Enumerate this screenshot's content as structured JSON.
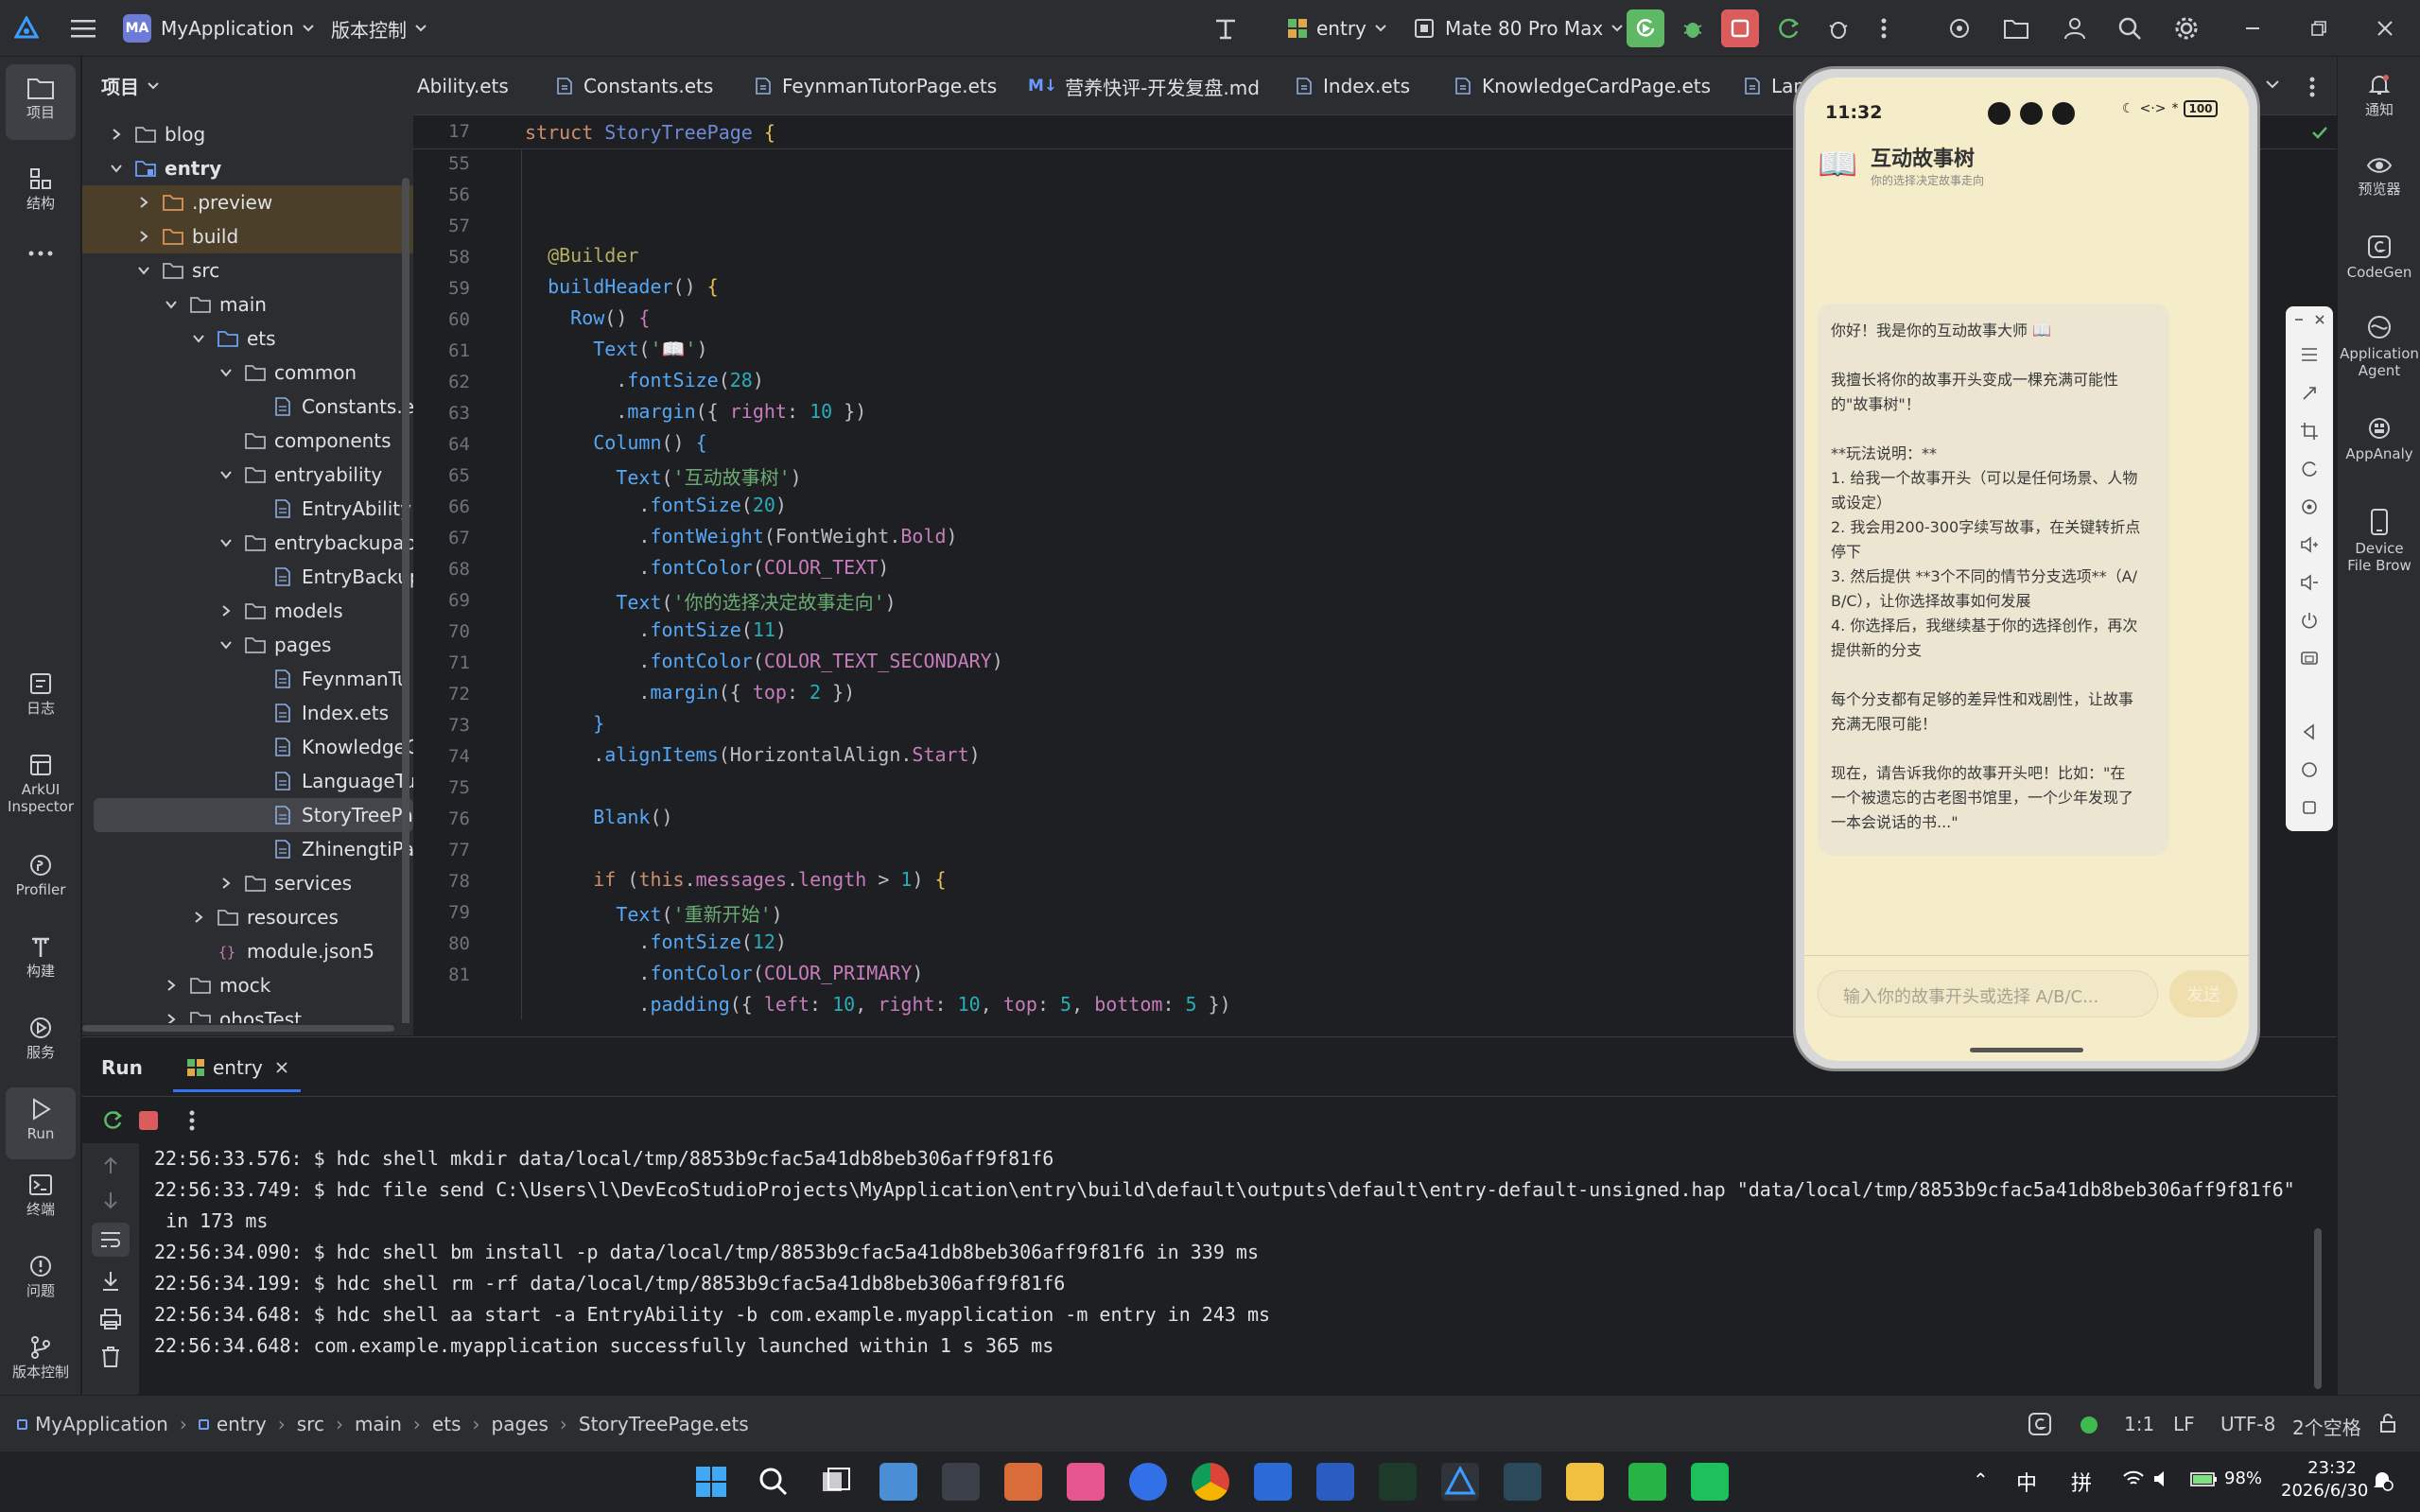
{
  "titlebar": {
    "project_badge": "MA",
    "project_name": "MyApplication",
    "vcs": "版本控制",
    "run_config": "entry",
    "device": "Mate 80 Pro Max"
  },
  "leftbar": {
    "items": [
      "项目",
      "结构",
      "日志",
      "ArkUI Inspector",
      "Profiler",
      "构建",
      "服务",
      "Run",
      "终端",
      "问题",
      "版本控制"
    ]
  },
  "project": {
    "title": "项目",
    "tree": [
      {
        "label": "blog",
        "depth": 1,
        "type": "folder",
        "exp": "closed"
      },
      {
        "label": "entry",
        "depth": 1,
        "type": "module",
        "exp": "open",
        "bold": true
      },
      {
        "label": ".preview",
        "depth": 2,
        "type": "folder-orange",
        "exp": "closed"
      },
      {
        "label": "build",
        "depth": 2,
        "type": "folder-orange",
        "exp": "closed"
      },
      {
        "label": "src",
        "depth": 2,
        "type": "folder",
        "exp": "open"
      },
      {
        "label": "main",
        "depth": 3,
        "type": "folder",
        "exp": "open"
      },
      {
        "label": "ets",
        "depth": 4,
        "type": "folder-blue",
        "exp": "open"
      },
      {
        "label": "common",
        "depth": 5,
        "type": "folder",
        "exp": "open"
      },
      {
        "label": "Constants.e",
        "depth": 6,
        "type": "file",
        "exp": "none"
      },
      {
        "label": "components",
        "depth": 5,
        "type": "folder",
        "exp": "none"
      },
      {
        "label": "entryability",
        "depth": 5,
        "type": "folder",
        "exp": "open"
      },
      {
        "label": "EntryAbility",
        "depth": 6,
        "type": "file",
        "exp": "none"
      },
      {
        "label": "entrybackupab",
        "depth": 5,
        "type": "folder",
        "exp": "open"
      },
      {
        "label": "EntryBackup",
        "depth": 6,
        "type": "file",
        "exp": "none"
      },
      {
        "label": "models",
        "depth": 5,
        "type": "folder",
        "exp": "closed"
      },
      {
        "label": "pages",
        "depth": 5,
        "type": "folder",
        "exp": "open"
      },
      {
        "label": "FeynmanTu",
        "depth": 6,
        "type": "file",
        "exp": "none"
      },
      {
        "label": "Index.ets",
        "depth": 6,
        "type": "file",
        "exp": "none"
      },
      {
        "label": "KnowledgeC",
        "depth": 6,
        "type": "file",
        "exp": "none"
      },
      {
        "label": "LanguageTu",
        "depth": 6,
        "type": "file",
        "exp": "none"
      },
      {
        "label": "StoryTreePa",
        "depth": 6,
        "type": "file",
        "exp": "none",
        "selected": true
      },
      {
        "label": "ZhinengtiPa",
        "depth": 6,
        "type": "file",
        "exp": "none"
      },
      {
        "label": "services",
        "depth": 5,
        "type": "folder",
        "exp": "closed"
      },
      {
        "label": "resources",
        "depth": 4,
        "type": "folder",
        "exp": "closed"
      },
      {
        "label": "module.json5",
        "depth": 4,
        "type": "json",
        "exp": "none"
      },
      {
        "label": "mock",
        "depth": 3,
        "type": "folder",
        "exp": "closed"
      },
      {
        "label": "ohosTest",
        "depth": 3,
        "type": "folder",
        "exp": "closed"
      }
    ]
  },
  "tabs": [
    {
      "label": "Ability.ets",
      "icon": "ets"
    },
    {
      "label": "Constants.ets",
      "icon": "ets"
    },
    {
      "label": "FeynmanTutorPage.ets",
      "icon": "ets"
    },
    {
      "label": "营养快评-开发复盘.md",
      "icon": "md"
    },
    {
      "label": "Index.ets",
      "icon": "ets"
    },
    {
      "label": "KnowledgeCardPage.ets",
      "icon": "ets"
    },
    {
      "label": "Lang",
      "icon": "ets"
    }
  ],
  "editor": {
    "sticky_line": "17",
    "sticky_text": "struct StoryTreePage {",
    "line_numbers": [
      "55",
      "56",
      "57",
      "58",
      "59",
      "60",
      "61",
      "62",
      "63",
      "64",
      "65",
      "66",
      "67",
      "68",
      "69",
      "70",
      "71",
      "72",
      "73",
      "74",
      "75",
      "76",
      "77",
      "78",
      "79",
      "80",
      "81"
    ]
  },
  "run": {
    "tab_run": "Run",
    "tab_entry": "entry",
    "log": [
      "22:56:33.576: $ hdc shell mkdir data/local/tmp/8853b9cfac5a41db8beb306aff9f81f6",
      "22:56:33.749: $ hdc file send C:\\Users\\l\\DevEcoStudioProjects\\MyApplication\\entry\\build\\default\\outputs\\default\\entry-default-unsigned.hap \"data/local/tmp/8853b9cfac5a41db8beb306aff9f81f6\"",
      " in 173 ms",
      "22:56:34.090: $ hdc shell bm install -p data/local/tmp/8853b9cfac5a41db8beb306aff9f81f6 in 339 ms",
      "22:56:34.199: $ hdc shell rm -rf data/local/tmp/8853b9cfac5a41db8beb306aff9f81f6",
      "22:56:34.648: $ hdc shell aa start -a EntryAbility -b com.example.myapplication -m entry in 243 ms",
      "22:56:34.648: com.example.myapplication successfully launched within 1 s 365 ms"
    ]
  },
  "rightbar": {
    "items": [
      "通知",
      "预览器",
      "CodeGen",
      "Application Agent",
      "AppAnaly",
      "Device File Brow"
    ]
  },
  "phone": {
    "time": "11:32",
    "battery": "100",
    "app_icon": "📖",
    "app_title": "互动故事树",
    "app_subtitle": "你的选择决定故事走向",
    "message": [
      "你好！我是你的互动故事大师 📖",
      "",
      "我擅长将你的故事开头变成一棵充满可能性",
      "的\"故事树\"！",
      "",
      "**玩法说明：**",
      "1. 给我一个故事开头（可以是任何场景、人物",
      "或设定）",
      "2. 我会用200-300字续写故事，在关键转折点",
      "停下",
      "3. 然后提供 **3个不同的情节分支选项**（A/",
      "B/C），让你选择故事如何发展",
      "4. 你选择后，我继续基于你的选择创作，再次",
      "提供新的分支",
      "",
      "每个分支都有足够的差异性和戏剧性，让故事",
      "充满无限可能！",
      "",
      "现在，请告诉我你的故事开头吧！比如：\"在",
      "一个被遗忘的古老图书馆里，一个少年发现了",
      "一本会说话的书...\""
    ],
    "input_placeholder": "输入你的故事开头或选择 A/B/C...",
    "send_label": "发送"
  },
  "statusbar": {
    "breadcrumb": [
      "MyApplication",
      "entry",
      "src",
      "main",
      "ets",
      "pages",
      "StoryTreePage.ets"
    ],
    "position": "1:1",
    "line_sep": "LF",
    "encoding": "UTF-8",
    "indent": "2个空格"
  },
  "taskbar": {
    "ime1": "中",
    "ime2": "拼",
    "battery": "98%",
    "time": "23:32",
    "date": "2026/6/30"
  },
  "colors": {
    "accent": "#3574f0",
    "run_green": "#5fb865",
    "stop_red": "#db5c5c",
    "phone_bg": "#f5ecca"
  }
}
